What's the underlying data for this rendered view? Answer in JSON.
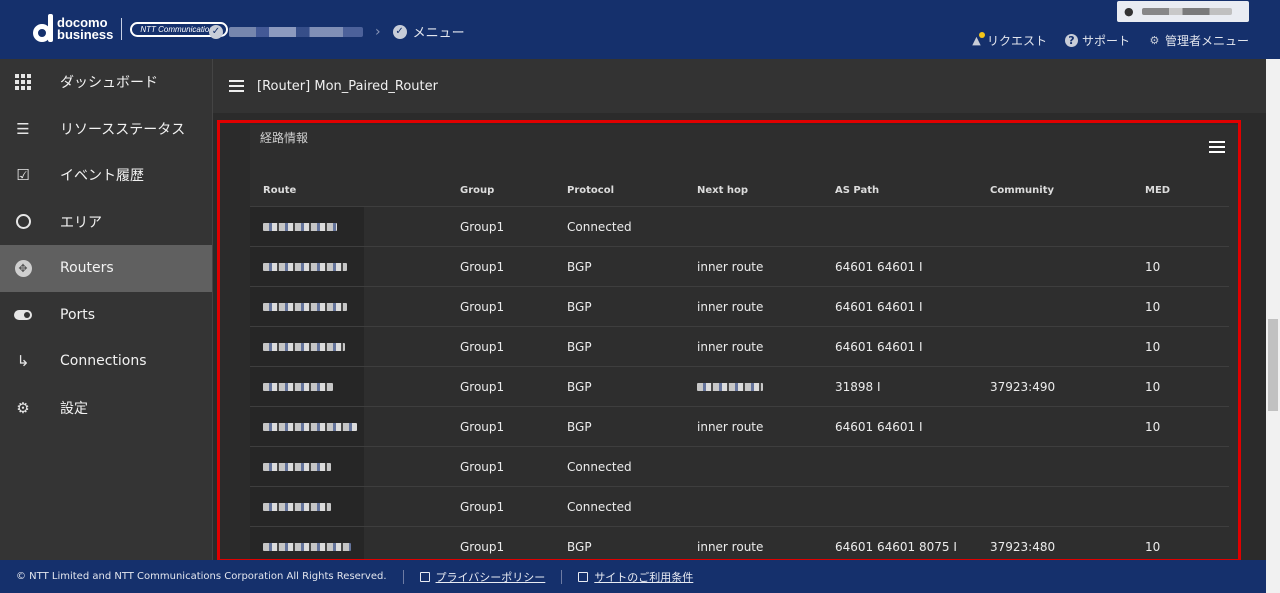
{
  "header": {
    "logo_line1": "docomo",
    "logo_line2": "business",
    "partner_logo": "NTT Communications",
    "breadcrumb_menu": "メニュー",
    "links": {
      "request": "リクエスト",
      "support": "サポート",
      "admin_menu": "管理者メニュー"
    }
  },
  "sidebar": {
    "items": [
      {
        "label": "ダッシュボード",
        "icon": "grid-icon"
      },
      {
        "label": "リソースステータス",
        "icon": "list-check-icon"
      },
      {
        "label": "イベント履歴",
        "icon": "calendar-check-icon"
      },
      {
        "label": "エリア",
        "icon": "globe-icon"
      },
      {
        "label": "Routers",
        "icon": "router-icon",
        "active": true
      },
      {
        "label": "Ports",
        "icon": "toggle-icon"
      },
      {
        "label": "Connections",
        "icon": "connection-icon"
      },
      {
        "label": "設定",
        "icon": "gear-icon"
      }
    ]
  },
  "main": {
    "title": "[Router] Mon_Paired_Router",
    "panel_title": "経路情報",
    "columns": [
      "Route",
      "Group",
      "Protocol",
      "Next hop",
      "AS Path",
      "Community",
      "MED"
    ],
    "rows": [
      {
        "group": "Group1",
        "protocol": "Connected",
        "next_hop": "",
        "as_path": "",
        "community": "",
        "med": ""
      },
      {
        "group": "Group1",
        "protocol": "BGP",
        "next_hop": "inner route",
        "as_path": "64601 64601 I",
        "community": "",
        "med": "10"
      },
      {
        "group": "Group1",
        "protocol": "BGP",
        "next_hop": "inner route",
        "as_path": "64601 64601 I",
        "community": "",
        "med": "10"
      },
      {
        "group": "Group1",
        "protocol": "BGP",
        "next_hop": "inner route",
        "as_path": "64601 64601 I",
        "community": "",
        "med": "10"
      },
      {
        "group": "Group1",
        "protocol": "BGP",
        "next_hop": "",
        "as_path": "31898 I",
        "community": "37923:490",
        "med": "10"
      },
      {
        "group": "Group1",
        "protocol": "BGP",
        "next_hop": "inner route",
        "as_path": "64601 64601 I",
        "community": "",
        "med": "10"
      },
      {
        "group": "Group1",
        "protocol": "Connected",
        "next_hop": "",
        "as_path": "",
        "community": "",
        "med": ""
      },
      {
        "group": "Group1",
        "protocol": "Connected",
        "next_hop": "",
        "as_path": "",
        "community": "",
        "med": ""
      },
      {
        "group": "Group1",
        "protocol": "BGP",
        "next_hop": "inner route",
        "as_path": "64601 64601 8075 I",
        "community": "37923:480",
        "med": "10"
      }
    ]
  },
  "footer": {
    "copyright": "© NTT Limited and NTT Communications Corporation All Rights Reserved.",
    "privacy": "プライバシーポリシー",
    "terms": "サイトのご利用条件"
  },
  "colors": {
    "header_bg": "#15306c",
    "sidebar_bg": "#343434",
    "active_item_bg": "#606060",
    "highlight_border": "#e00000"
  }
}
